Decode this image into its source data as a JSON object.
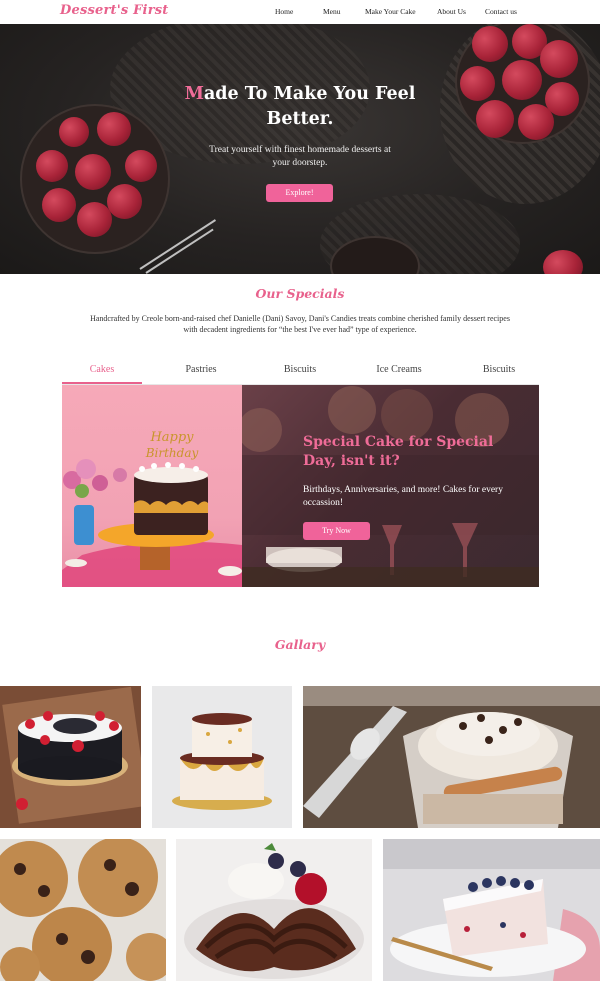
{
  "brand": {
    "name": "Dessert's First",
    "accent": "#e8618c"
  },
  "nav": {
    "items": [
      {
        "label": "Home"
      },
      {
        "label": "Menu"
      },
      {
        "label": "Make Your Cake"
      },
      {
        "label": "About Us"
      },
      {
        "label": "Contact us"
      }
    ]
  },
  "hero": {
    "title_first": "M",
    "title_rest": "ade To Make You Feel Better.",
    "subtitle": "Treat yourself with finest homemade desserts at your doorstep.",
    "button": "Explore!"
  },
  "specials": {
    "title": "Our Specials",
    "description": "Handcrafted by Creole born-and-raised chef Danielle (Dani) Savoy, Dani's Candies treats combine cherished family dessert recipes with decadent ingredients for “the best I've ever had” type of experience.",
    "tabs": [
      {
        "label": "Cakes",
        "active": true
      },
      {
        "label": "Pastries",
        "active": false
      },
      {
        "label": "Biscuits",
        "active": false
      },
      {
        "label": "Ice Creams",
        "active": false
      },
      {
        "label": "Biscuits",
        "active": false
      }
    ],
    "card": {
      "heading": "Special Cake for Special Day, isn't it?",
      "text": "Birthdays, Anniversaries, and more! Cakes for every occassion!",
      "button": "Try Now",
      "topper_line1": "Happy",
      "topper_line2": "Birthday"
    }
  },
  "gallery": {
    "title": "Gallary",
    "images": [
      {
        "name": "black-forest-cake"
      },
      {
        "name": "two-tier-cake"
      },
      {
        "name": "chocolate-mousse-cup"
      },
      {
        "name": "chocolate-chip-cookies"
      },
      {
        "name": "chocolate-pasta-dessert"
      },
      {
        "name": "blueberry-cake-slice"
      }
    ]
  }
}
